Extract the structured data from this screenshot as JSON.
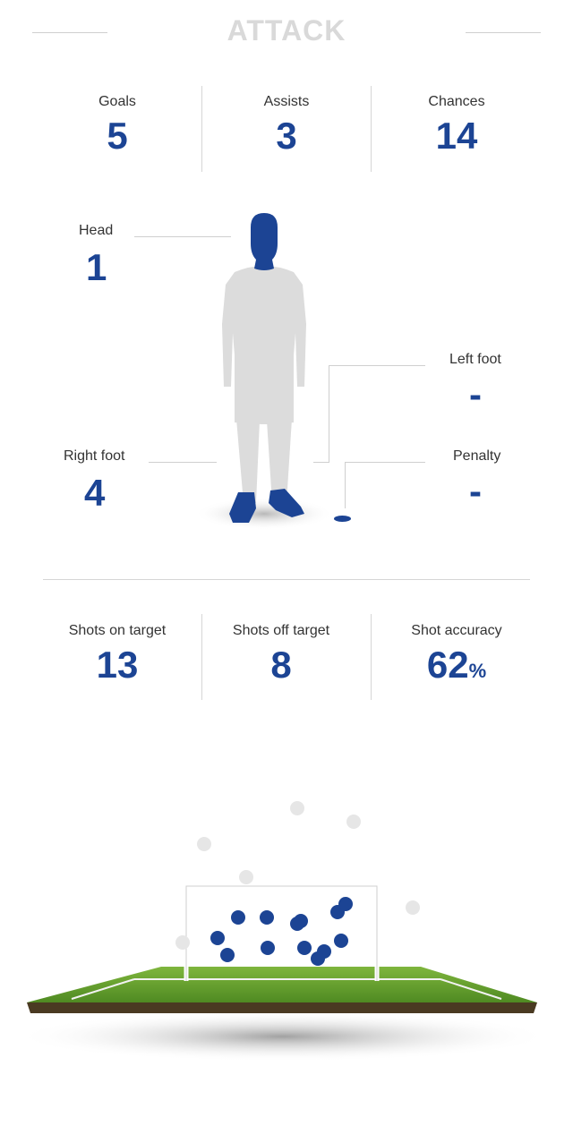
{
  "title": "ATTACK",
  "top_stats": [
    {
      "label": "Goals",
      "value": "5"
    },
    {
      "label": "Assists",
      "value": "3"
    },
    {
      "label": "Chances",
      "value": "14"
    }
  ],
  "body_stats": {
    "head": {
      "label": "Head",
      "value": "1"
    },
    "left_foot": {
      "label": "Left foot",
      "value": "-"
    },
    "right_foot": {
      "label": "Right foot",
      "value": "4"
    },
    "penalty": {
      "label": "Penalty",
      "value": "-"
    }
  },
  "shot_stats": [
    {
      "label": "Shots on target",
      "value": "13"
    },
    {
      "label": "Shots off target",
      "value": "8"
    },
    {
      "label": "Shot accuracy",
      "value": "62",
      "unit": "%"
    }
  ],
  "colors": {
    "accent": "#1c4494",
    "muted": "#d9d9d9",
    "grass": "#5f9a2c",
    "soil": "#4a3a22"
  }
}
